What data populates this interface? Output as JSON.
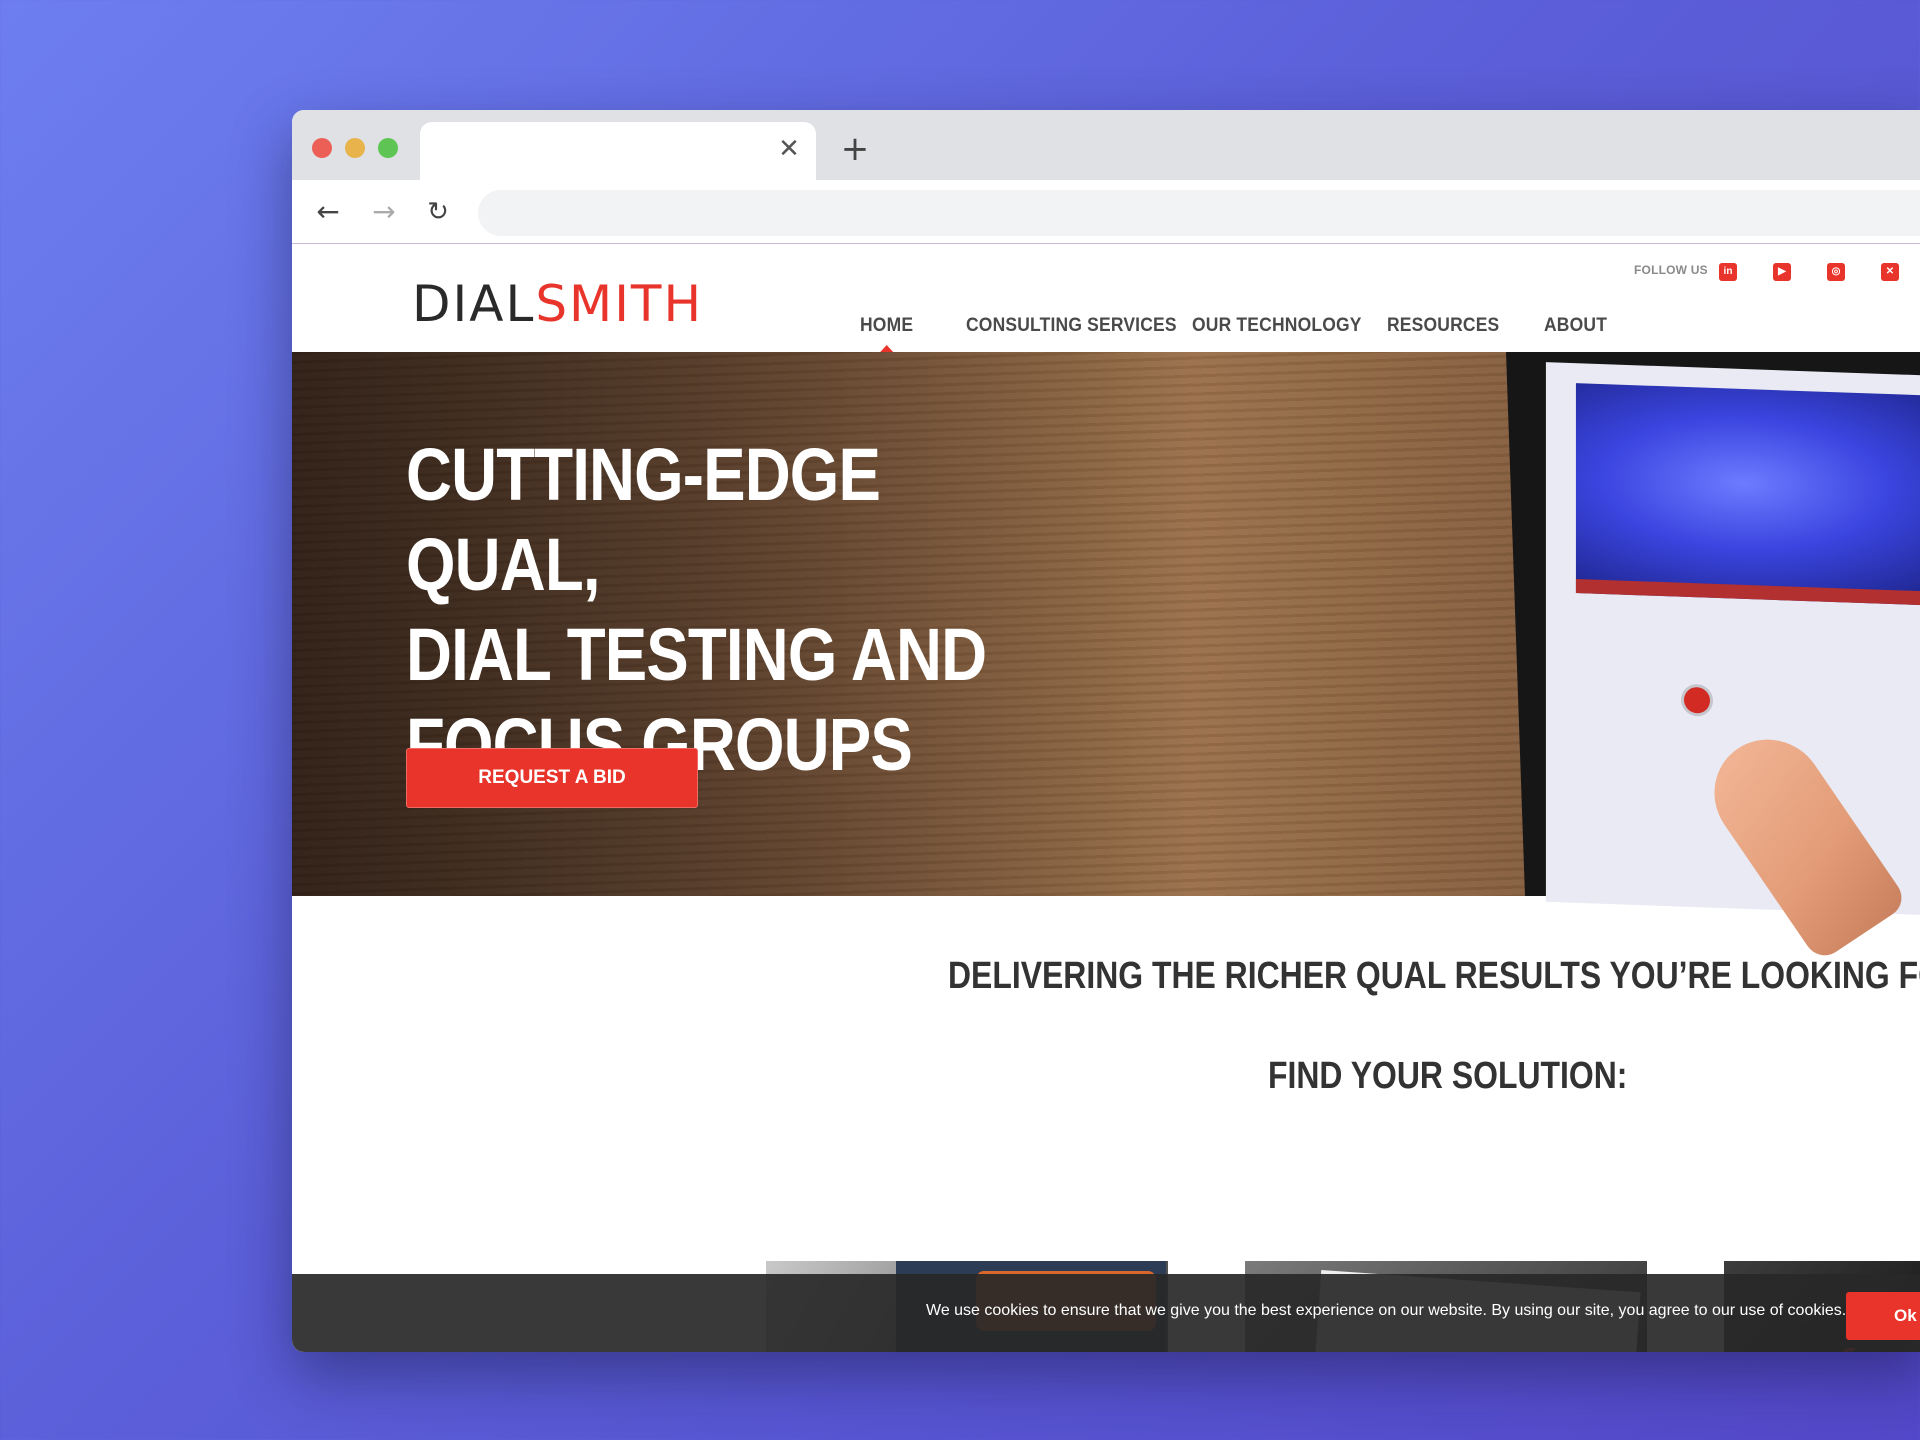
{
  "browser": {
    "tab_close_glyph": "✕",
    "new_tab_glyph": "+",
    "back_glyph": "←",
    "forward_glyph": "→",
    "reload_glyph": "↻",
    "url": ""
  },
  "header": {
    "logo_part1": "DIAL",
    "logo_part2": "SMITH",
    "follow_label": "FOLLOW US",
    "social": [
      "in",
      "▶",
      "◎",
      "✕"
    ],
    "menu": [
      "HOME",
      "CONSULTING SERVICES",
      "OUR TECHNOLOGY",
      "RESOURCES",
      "ABOUT"
    ],
    "active_menu": "HOME"
  },
  "hero": {
    "title_line1": "CUTTING-EDGE QUAL,",
    "title_line2": "DIAL TESTING AND",
    "title_line3": "FOCUS GROUPS",
    "cta_label": "REQUEST A BID"
  },
  "main": {
    "headline": "DELIVERING THE RICHER QUAL RESULTS YOU’RE LOOKING FOR",
    "subheadline": "FIND YOUR SOLUTION:"
  },
  "cookie": {
    "text": "We use cookies to ensure that we give you the best experience on our website. By using our site, you agree to our use of cookies.",
    "ok_label": "Ok"
  },
  "colors": {
    "accent": "#e8342a",
    "background_start": "#6d7ff0",
    "background_end": "#5348c9"
  }
}
